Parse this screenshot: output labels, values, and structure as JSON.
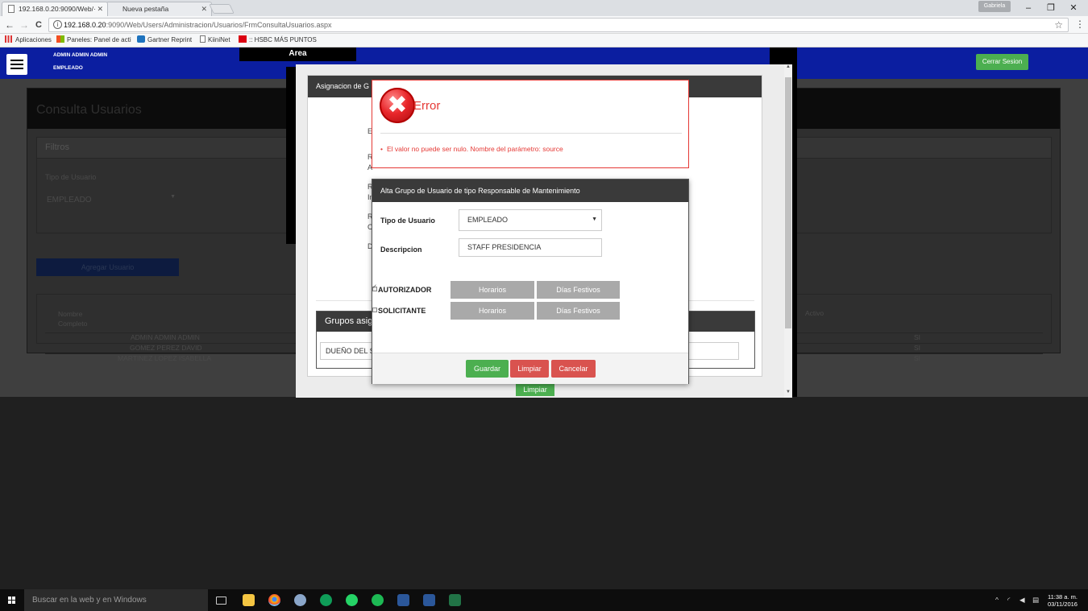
{
  "browser": {
    "tabs": [
      {
        "label": "192.168.0.20:9090/Web/·",
        "active": true
      },
      {
        "label": "Nueva pestaña",
        "active": false
      }
    ],
    "profile": "Gabriela",
    "window_controls": {
      "minimize": "–",
      "restore": "❐",
      "close": "✕"
    },
    "nav": {
      "back": "←",
      "forward": "→",
      "reload": "C"
    },
    "url_host": "192.168.0.20",
    "url_path": ":9090/Web/Users/Administracion/Usuarios/FrmConsultaUsuarios.aspx",
    "bookmarks": [
      "Aplicaciones",
      "Paneles: Panel de acti",
      "Gartner Reprint",
      "KiiniNet",
      ":: HSBC MÁS PUNTOS"
    ]
  },
  "header": {
    "user_name": "ADMIN ADMIN ADMIN",
    "user_role": "EMPLEADO",
    "area_label": "Area",
    "logout_label": "Cerrar Sesion"
  },
  "background_page": {
    "title": "Consulta Usuarios",
    "filters_title": "Filtros",
    "user_type_label": "Tipo de Usuario",
    "user_type_value": "EMPLEADO",
    "add_user_button": "Agregar Usuario",
    "table": {
      "col_name": "Nombre Completo",
      "col_active": "Activo",
      "rows": [
        {
          "name": "ADMIN ADMIN ADMIN",
          "active": "SI"
        },
        {
          "name": "GOMEZ PEREZ DAVID",
          "active": "SI"
        },
        {
          "name": "MARTINEZ LOPEZ ISABELLA",
          "active": "SI"
        }
      ]
    }
  },
  "assign_modal": {
    "title": "Asignacion de G",
    "letters": [
      "E",
      "R",
      "A",
      "R",
      "In",
      "R",
      "C",
      "D"
    ],
    "groups_title": "Grupos asign",
    "groups_input": "DUEÑO DEL S",
    "clear_button": "Limpiar"
  },
  "error_modal": {
    "title": "Error",
    "message": "El valor no puede ser nulo. Nombre del parámetro: source"
  },
  "alta_modal": {
    "title": "Alta Grupo de Usuario de tipo Responsable de Mantenimiento",
    "user_type_label": "Tipo de Usuario",
    "user_type_value": "EMPLEADO",
    "description_label": "Descripcion",
    "description_value": "STAFF PRESIDENCIA",
    "roles": [
      {
        "label": "AUTORIZADOR",
        "checked": true,
        "schedule_button": "Horarios",
        "holidays_button": "Días Festivos"
      },
      {
        "label": "SOLICITANTE",
        "checked": false,
        "schedule_button": "Horarios",
        "holidays_button": "Días Festivos"
      }
    ],
    "save_button": "Guardar",
    "clear_button": "Limpiar",
    "cancel_button": "Cancelar"
  },
  "taskbar": {
    "search_placeholder": "Buscar en la web y en Windows",
    "time": "11:38 a. m.",
    "date": "03/11/2016"
  },
  "colors": {
    "nav_blue": "#0b1ea0",
    "success_green": "#4caf50",
    "danger_red": "#d9534f",
    "error_red": "#e53935"
  }
}
